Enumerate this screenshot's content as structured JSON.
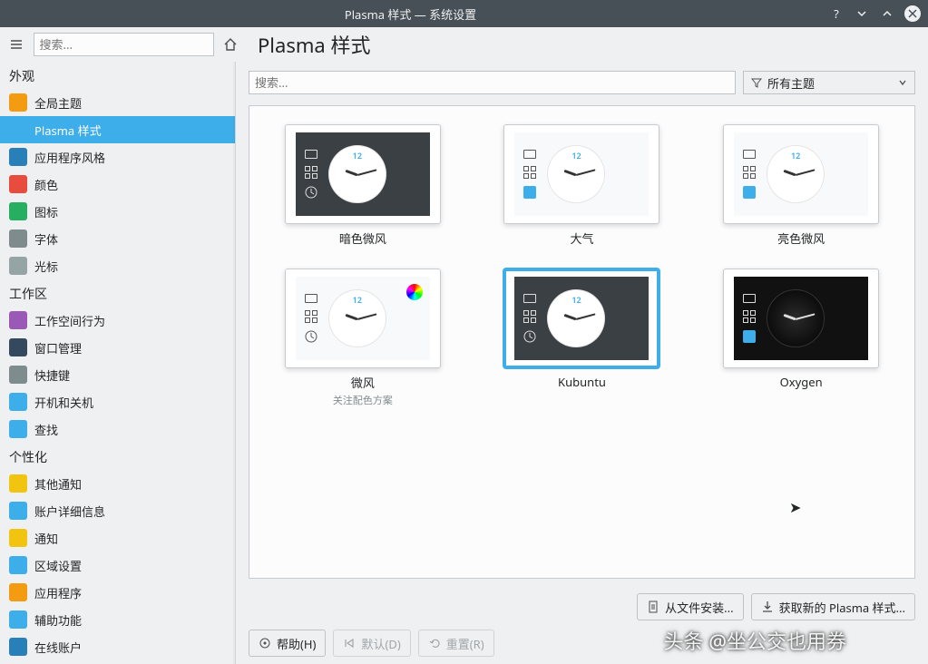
{
  "window": {
    "title": "Plasma 样式 — 系统设置"
  },
  "toolbar": {
    "search_placeholder": "搜索...",
    "page_title": "Plasma 样式"
  },
  "sidebar": {
    "sections": [
      {
        "header": "外观",
        "items": [
          {
            "label": "全局主题",
            "color": "#f39c12"
          },
          {
            "label": "Plasma 样式",
            "color": "#3daee9",
            "active": true
          },
          {
            "label": "应用程序风格",
            "color": "#2980b9"
          },
          {
            "label": "颜色",
            "color": "#e74c3c"
          },
          {
            "label": "图标",
            "color": "#27ae60"
          },
          {
            "label": "字体",
            "color": "#7f8c8d"
          },
          {
            "label": "光标",
            "color": "#95a5a6"
          }
        ]
      },
      {
        "header": "工作区",
        "items": [
          {
            "label": "工作空间行为",
            "color": "#9b59b6"
          },
          {
            "label": "窗口管理",
            "color": "#34495e"
          },
          {
            "label": "快捷键",
            "color": "#7f8c8d"
          },
          {
            "label": "开机和关机",
            "color": "#3daee9"
          },
          {
            "label": "查找",
            "color": "#3daee9"
          }
        ]
      },
      {
        "header": "个性化",
        "items": [
          {
            "label": "其他通知",
            "color": "#f1c40f"
          },
          {
            "label": "账户详细信息",
            "color": "#3daee9"
          },
          {
            "label": "通知",
            "color": "#f1c40f"
          },
          {
            "label": "区域设置",
            "color": "#3daee9"
          },
          {
            "label": "应用程序",
            "color": "#f39c12"
          },
          {
            "label": "辅助功能",
            "color": "#3daee9"
          },
          {
            "label": "在线账户",
            "color": "#2980b9"
          }
        ]
      }
    ]
  },
  "content": {
    "search_placeholder": "搜索...",
    "filter_label": "所有主题",
    "themes": [
      {
        "name": "暗色微风",
        "variant": "dark"
      },
      {
        "name": "大气",
        "variant": "light"
      },
      {
        "name": "亮色微风",
        "variant": "light"
      },
      {
        "name": "微风",
        "subtitle": "关注配色方案",
        "variant": "light",
        "colorwheel": true
      },
      {
        "name": "Kubuntu",
        "variant": "dark",
        "selected": true
      },
      {
        "name": "Oxygen",
        "variant": "black"
      }
    ]
  },
  "buttons": {
    "install_from_file": "从文件安装...",
    "get_new": "获取新的 Plasma 样式...",
    "help": "帮助(H)",
    "defaults": "默认(D)",
    "reset": "重置(R)"
  },
  "watermark": "头条 @坐公交也用券"
}
